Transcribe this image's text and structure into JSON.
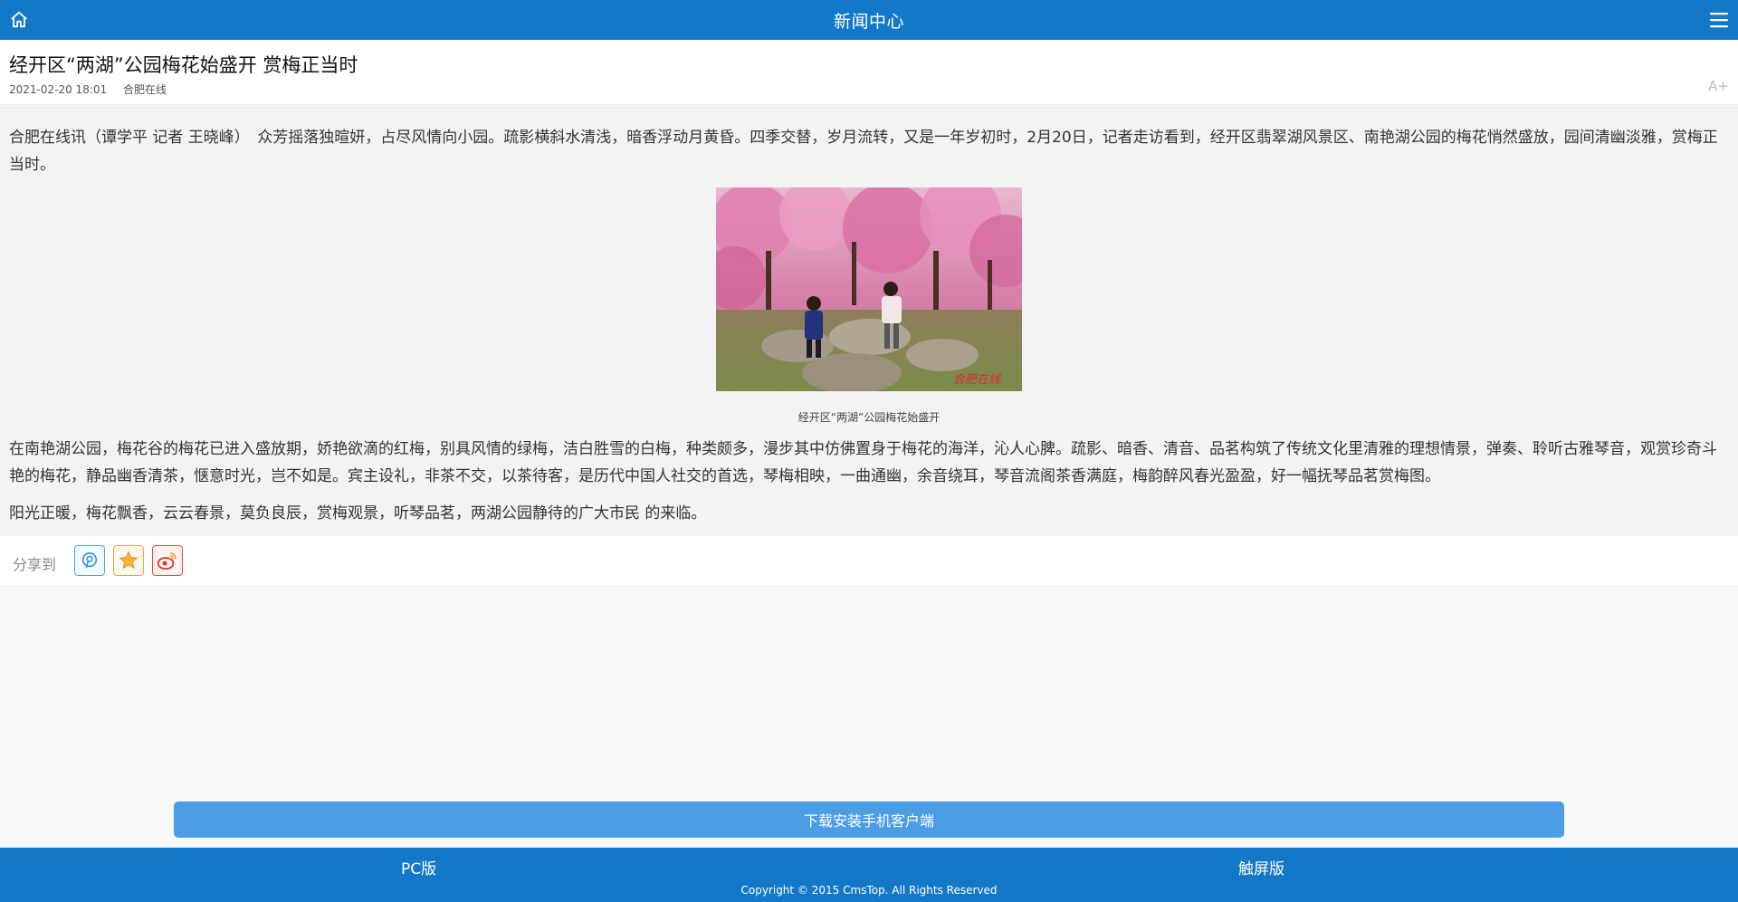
{
  "header": {
    "title": "新闻中心"
  },
  "article": {
    "title": "经开区“两湖”公园梅花始盛开 赏梅正当时",
    "date": "2021-02-20 18:01",
    "source": "合肥在线",
    "font_size_label": "A+",
    "paragraphs": [
      "合肥在线讯（谭学平 记者 王晓峰）　众芳摇落独暄妍，占尽风情向小园。疏影横斜水清浅，暗香浮动月黄昏。四季交替，岁月流转，又是一年岁初时，2月20日，记者走访看到，经开区翡翠湖风景区、南艳湖公园的梅花悄然盛放，园间清幽淡雅，赏梅正当时。",
      "在南艳湖公园，梅花谷的梅花已进入盛放期，娇艳欲滴的红梅，别具风情的绿梅，洁白胜雪的白梅，种类颇多，漫步其中仿佛置身于梅花的海洋，沁人心脾。疏影、暗香、清音、品茗构筑了传统文化里清雅的理想情景，弹奏、聆听古雅琴音，观赏珍奇斗艳的梅花，静品幽香清茶，惬意时光，岂不如是。宾主设礼，非茶不交，以茶待客，是历代中国人社交的首选，琴梅相映，一曲通幽，余音绕耳，琴音流阁茶香满庭，梅韵醉风春光盈盈，好一幅抚琴品茗赏梅图。",
      "阳光正暖，梅花飘香，云云春景，莫负良辰，赏梅观景，听琴品茗，两湖公园静待的广大市民 的来临。"
    ],
    "image_caption": "经开区“两湖”公园梅花始盛开",
    "image_watermark": "合肥在线"
  },
  "share": {
    "label": "分享到",
    "icons": [
      "qq-icon",
      "favorite-star-icon",
      "weibo-icon"
    ]
  },
  "download": {
    "label": "下载安装手机客户端"
  },
  "footer": {
    "pc_label": "PC版",
    "touch_label": "触屏版",
    "copyright": "Copyright © 2015 CmsTop. All Rights Reserved"
  },
  "colors": {
    "brand_blue": "#1478c8",
    "button_blue": "#4b9de6"
  }
}
